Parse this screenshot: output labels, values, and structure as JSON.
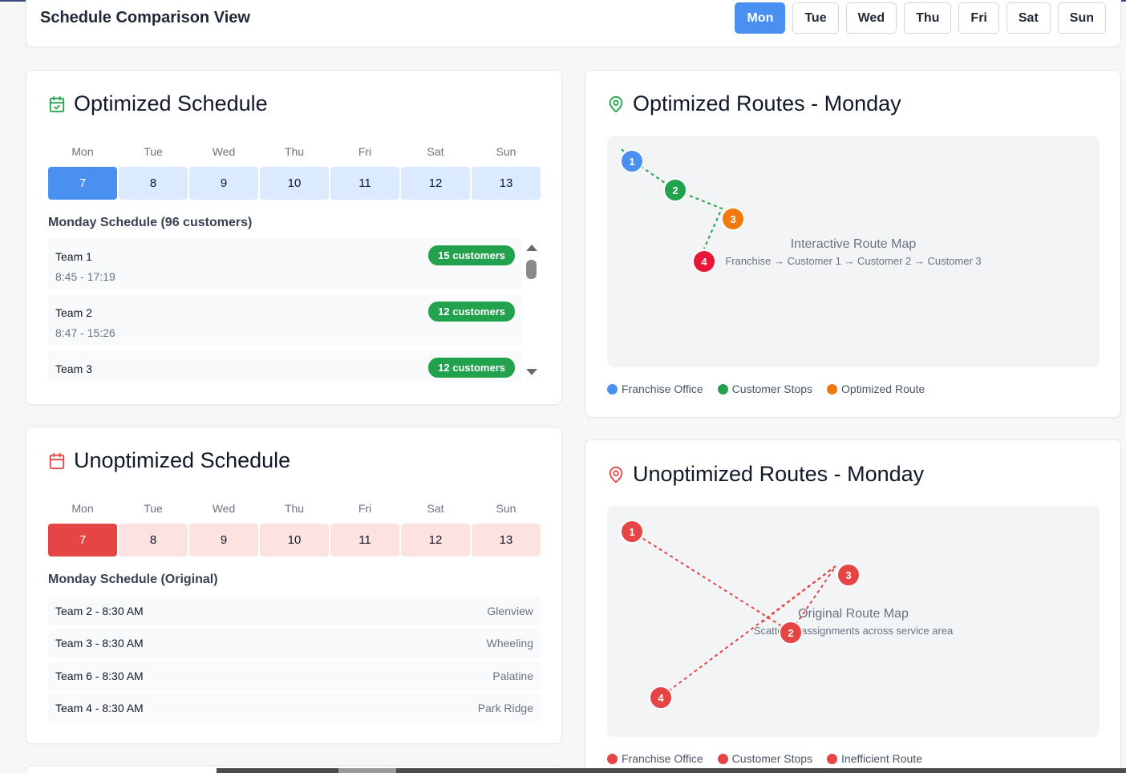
{
  "header": {
    "title": "Schedule Comparison View",
    "days": [
      "Mon",
      "Tue",
      "Wed",
      "Thu",
      "Fri",
      "Sat",
      "Sun"
    ],
    "active_day": "Mon"
  },
  "optimized_schedule": {
    "title": "Optimized Schedule",
    "icon": "calendar-check-icon",
    "week_labels": [
      "Mon",
      "Tue",
      "Wed",
      "Thu",
      "Fri",
      "Sat",
      "Sun"
    ],
    "dates": [
      "7",
      "8",
      "9",
      "10",
      "11",
      "12",
      "13"
    ],
    "selected_date": "7",
    "section_title": "Monday Schedule (96 customers)",
    "teams": [
      {
        "name": "Team 1",
        "time": "8:45 - 17:19",
        "badge": "15 customers"
      },
      {
        "name": "Team 2",
        "time": "8:47 - 15:26",
        "badge": "12 customers"
      },
      {
        "name": "Team 3",
        "time": "",
        "badge": "12 customers"
      }
    ]
  },
  "unoptimized_schedule": {
    "title": "Unoptimized Schedule",
    "icon": "calendar-icon",
    "week_labels": [
      "Mon",
      "Tue",
      "Wed",
      "Thu",
      "Fri",
      "Sat",
      "Sun"
    ],
    "dates": [
      "7",
      "8",
      "9",
      "10",
      "11",
      "12",
      "13"
    ],
    "selected_date": "7",
    "section_title": "Monday Schedule (Original)",
    "rows": [
      {
        "label": "Team 2 - 8:30 AM",
        "location": "Glenview"
      },
      {
        "label": "Team 3 - 8:30 AM",
        "location": "Wheeling"
      },
      {
        "label": "Team 6 - 8:30 AM",
        "location": "Palatine"
      },
      {
        "label": "Team 4 - 8:30 AM",
        "location": "Park Ridge"
      }
    ]
  },
  "optimized_routes": {
    "title": "Optimized Routes - Monday",
    "icon": "map-pin-icon",
    "map_title": "Interactive Route Map",
    "map_subtitle": "Franchise → Customer 1 → Customer 2 → Customer 3",
    "markers": [
      "1",
      "2",
      "3",
      "4"
    ],
    "marker_colors": [
      "#4a90f0",
      "#23a24d",
      "#f07a0e",
      "#e8173a"
    ],
    "legend": [
      {
        "label": "Franchise Office",
        "color": "#4a90f0"
      },
      {
        "label": "Customer Stops",
        "color": "#23a24d"
      },
      {
        "label": "Optimized Route",
        "color": "#f07a0e"
      }
    ]
  },
  "unoptimized_routes": {
    "title": "Unoptimized Routes - Monday",
    "icon": "map-pin-icon",
    "map_title": "Original Route Map",
    "map_subtitle": "Scattered assignments across service area",
    "markers": [
      "1",
      "2",
      "3",
      "4"
    ],
    "marker_color": "#e64545",
    "legend": [
      {
        "label": "Franchise Office",
        "color": "#e64545"
      },
      {
        "label": "Customer Stops",
        "color": "#e64545"
      },
      {
        "label": "Inefficient Route",
        "color": "#e64545"
      }
    ]
  },
  "colors": {
    "accent_blue": "#4a90f0",
    "accent_red": "#e64545",
    "badge_green": "#23a24d"
  }
}
